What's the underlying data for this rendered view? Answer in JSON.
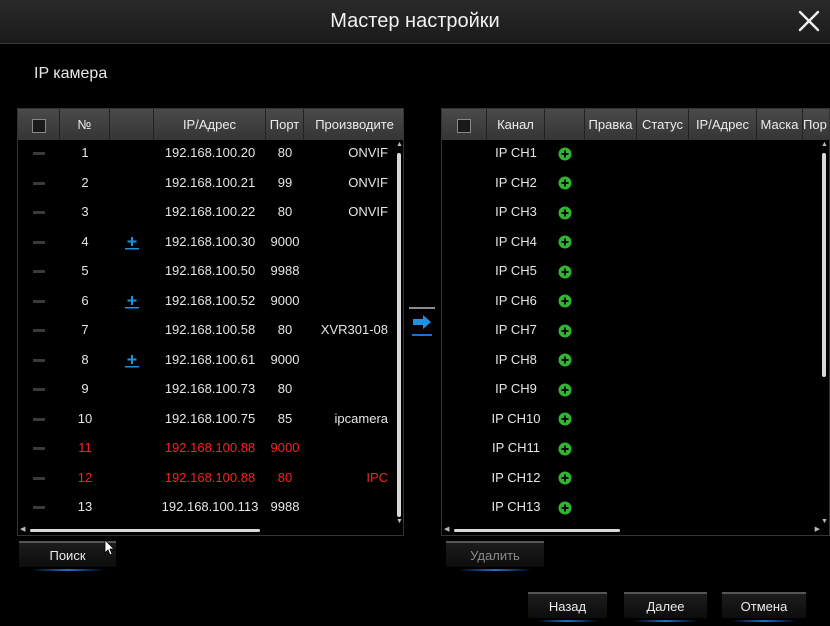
{
  "window": {
    "title": "Мастер настройки"
  },
  "section": {
    "label": "IP камера"
  },
  "found_table": {
    "headers": {
      "no": "№",
      "ip": "IP/Адрес",
      "port": "Порт",
      "vendor": "Производите"
    },
    "rows": [
      {
        "no": "1",
        "ip": "192.168.100.20",
        "port": "80",
        "vendor": "ONVIF",
        "added": false,
        "alert": false
      },
      {
        "no": "2",
        "ip": "192.168.100.21",
        "port": "99",
        "vendor": "ONVIF",
        "added": false,
        "alert": false
      },
      {
        "no": "3",
        "ip": "192.168.100.22",
        "port": "80",
        "vendor": "ONVIF",
        "added": false,
        "alert": false
      },
      {
        "no": "4",
        "ip": "192.168.100.30",
        "port": "9000",
        "vendor": "",
        "added": true,
        "alert": false
      },
      {
        "no": "5",
        "ip": "192.168.100.50",
        "port": "9988",
        "vendor": "",
        "added": false,
        "alert": false
      },
      {
        "no": "6",
        "ip": "192.168.100.52",
        "port": "9000",
        "vendor": "",
        "added": true,
        "alert": false
      },
      {
        "no": "7",
        "ip": "192.168.100.58",
        "port": "80",
        "vendor": "XVR301-08",
        "added": false,
        "alert": false
      },
      {
        "no": "8",
        "ip": "192.168.100.61",
        "port": "9000",
        "vendor": "",
        "added": true,
        "alert": false
      },
      {
        "no": "9",
        "ip": "192.168.100.73",
        "port": "80",
        "vendor": "",
        "added": false,
        "alert": false
      },
      {
        "no": "10",
        "ip": "192.168.100.75",
        "port": "85",
        "vendor": "ipcamera",
        "added": false,
        "alert": false
      },
      {
        "no": "11",
        "ip": "192.168.100.88",
        "port": "9000",
        "vendor": "",
        "added": false,
        "alert": true
      },
      {
        "no": "12",
        "ip": "192.168.100.88",
        "port": "80",
        "vendor": "IPC",
        "added": false,
        "alert": true
      },
      {
        "no": "13",
        "ip": "192.168.100.113",
        "port": "9988",
        "vendor": "",
        "added": false,
        "alert": false
      }
    ]
  },
  "channel_table": {
    "headers": {
      "channel": "Канал",
      "edit": "Правка",
      "status": "Статус",
      "ip": "IP/Адрес",
      "mask": "Маска",
      "port": "Пор"
    },
    "channels": [
      "IP CH1",
      "IP CH2",
      "IP CH3",
      "IP CH4",
      "IP CH5",
      "IP CH6",
      "IP CH7",
      "IP CH8",
      "IP CH9",
      "IP CH10",
      "IP CH11",
      "IP CH12",
      "IP CH13"
    ]
  },
  "buttons": {
    "search": "Поиск",
    "delete": "Удалить",
    "back": "Назад",
    "next": "Далее",
    "cancel": "Отмена"
  },
  "colors": {
    "alert_text": "#ff1f1f",
    "add_icon": "#2fb52f",
    "accent": "#1f8fe0"
  },
  "icons": {
    "close": "close-icon",
    "transfer": "arrow-right-icon",
    "add_camera": "add-camera-icon",
    "add_channel": "plus-circle-icon"
  }
}
